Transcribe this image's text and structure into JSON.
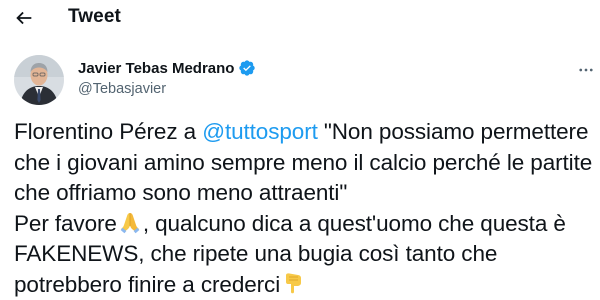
{
  "topbar": {
    "back_icon": "arrow-left-icon",
    "title": "Tweet"
  },
  "author": {
    "name": "Javier Tebas Medrano",
    "handle": "@Tebasjavier",
    "verified": true,
    "verified_icon": "verified-badge-icon",
    "avatar_icon": "avatar"
  },
  "more_icon": "more-dots-icon",
  "tweet": {
    "part1": "Florentino Pérez a ",
    "mention": "@tuttosport",
    "part2": " \"Non possiamo permettere che i giovani amino sempre meno il calcio perché le partite che offriamo sono meno attraenti\"\nPer favore",
    "emoji1": "folded-hands-emoji",
    "part3": ", qualcuno dica a quest'uomo che questa è FAKENEWS, che ripete una bugia così tanto che potrebbero finire a crederci",
    "emoji2": "pointing-down-emoji"
  },
  "colors": {
    "accent": "#1d9bf0",
    "text": "#0f1419",
    "secondary": "#536471"
  }
}
